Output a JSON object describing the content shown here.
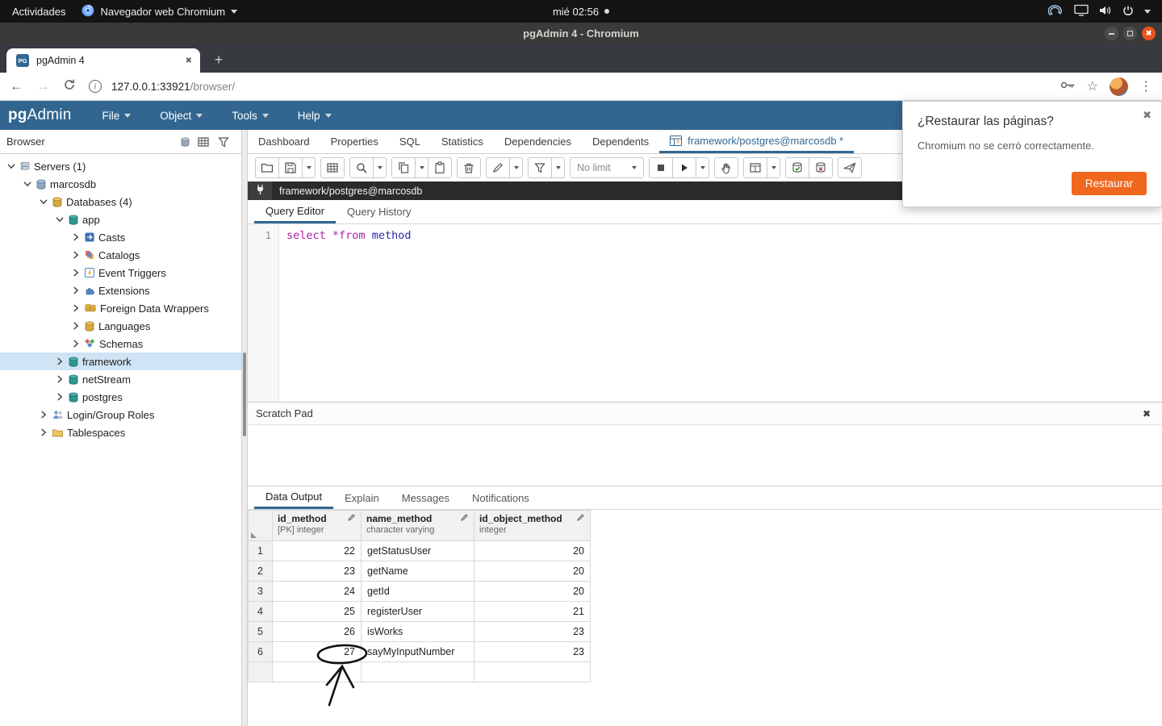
{
  "system_bar": {
    "activities_label": "Actividades",
    "app_menu_label": "Navegador web Chromium",
    "clock": "mié 02:56"
  },
  "window_title": "pgAdmin 4 - Chromium",
  "browser_chrome": {
    "tab_title": "pgAdmin 4",
    "tab_favicon": "PG",
    "url_host": "127.0.0.1:33921",
    "url_path": "/browser/"
  },
  "restore_popup": {
    "title": "¿Restaurar las páginas?",
    "message": "Chromium no se cerró correctamente.",
    "button_label": "Restaurar"
  },
  "pgadmin": {
    "logo": {
      "pg": "pg",
      "admin": "Admin"
    },
    "menus": [
      {
        "label": "File"
      },
      {
        "label": "Object"
      },
      {
        "label": "Tools"
      },
      {
        "label": "Help"
      }
    ],
    "browser_panel": {
      "title": "Browser"
    },
    "tree": [
      {
        "label": "Servers (1)",
        "level": 0,
        "expanded": true,
        "icon": "server-group"
      },
      {
        "label": "marcosdb",
        "level": 1,
        "expanded": true,
        "icon": "server"
      },
      {
        "label": "Databases (4)",
        "level": 2,
        "expanded": true,
        "icon": "db-group"
      },
      {
        "label": "app",
        "level": 3,
        "expanded": true,
        "icon": "database"
      },
      {
        "label": "Casts",
        "level": 4,
        "expanded": false,
        "icon": "casts"
      },
      {
        "label": "Catalogs",
        "level": 4,
        "expanded": false,
        "icon": "catalogs"
      },
      {
        "label": "Event Triggers",
        "level": 4,
        "expanded": false,
        "icon": "event-triggers"
      },
      {
        "label": "Extensions",
        "level": 4,
        "expanded": false,
        "icon": "extensions"
      },
      {
        "label": "Foreign Data Wrappers",
        "level": 4,
        "expanded": false,
        "icon": "fdw"
      },
      {
        "label": "Languages",
        "level": 4,
        "expanded": false,
        "icon": "languages"
      },
      {
        "label": "Schemas",
        "level": 4,
        "expanded": false,
        "icon": "schemas"
      },
      {
        "label": "framework",
        "level": 3,
        "expanded": false,
        "icon": "database",
        "selected": true
      },
      {
        "label": "netStream",
        "level": 3,
        "expanded": false,
        "icon": "database"
      },
      {
        "label": "postgres",
        "level": 3,
        "expanded": false,
        "icon": "database"
      },
      {
        "label": "Login/Group Roles",
        "level": 2,
        "expanded": false,
        "icon": "roles"
      },
      {
        "label": "Tablespaces",
        "level": 2,
        "expanded": false,
        "icon": "tablespaces"
      }
    ],
    "main_tabs": [
      {
        "label": "Dashboard"
      },
      {
        "label": "Properties"
      },
      {
        "label": "SQL"
      },
      {
        "label": "Statistics"
      },
      {
        "label": "Dependencies"
      },
      {
        "label": "Dependents"
      },
      {
        "label": "framework/postgres@marcosdb *",
        "active": true,
        "icon": "query-tool"
      }
    ],
    "toolbar": {
      "limit_label": "No limit",
      "groups": [
        {
          "buttons": [
            {
              "name": "open-file-button",
              "icon": "folder-open"
            },
            {
              "name": "save-file-button",
              "icon": "save",
              "dropdown": true
            }
          ]
        },
        {
          "buttons": [
            {
              "name": "save-data-changes-button",
              "icon": "grid"
            }
          ]
        },
        {
          "buttons": [
            {
              "name": "find-button",
              "icon": "search",
              "dropdown": true
            }
          ]
        },
        {
          "buttons": [
            {
              "name": "copy-button",
              "icon": "copy",
              "dropdown": true
            },
            {
              "name": "paste-button",
              "icon": "paste"
            }
          ]
        },
        {
          "buttons": [
            {
              "name": "delete-button",
              "icon": "trash"
            }
          ]
        },
        {
          "buttons": [
            {
              "name": "edit-button",
              "icon": "pencil",
              "dropdown": true
            }
          ]
        },
        {
          "buttons": [
            {
              "name": "filter-button",
              "icon": "funnel",
              "dropdown": true
            }
          ]
        },
        {
          "type": "limit"
        },
        {
          "buttons": [
            {
              "name": "cancel-query-button",
              "icon": "stop"
            },
            {
              "name": "execute-button",
              "icon": "play",
              "dropdown": true
            }
          ]
        },
        {
          "buttons": [
            {
              "name": "explain-button",
              "icon": "hand"
            }
          ]
        },
        {
          "buttons": [
            {
              "name": "explain-settings-button",
              "icon": "table",
              "dropdown": true
            }
          ]
        },
        {
          "buttons": [
            {
              "name": "commit-button",
              "icon": "db-commit"
            },
            {
              "name": "rollback-button",
              "icon": "db-rollback"
            }
          ]
        },
        {
          "buttons": [
            {
              "name": "download-csv-button",
              "icon": "plane"
            }
          ]
        }
      ]
    },
    "connection_label": "framework/postgres@marcosdb",
    "editor_tabs": [
      {
        "label": "Query Editor",
        "active": true
      },
      {
        "label": "Query History"
      }
    ],
    "editor": {
      "line_number": "1",
      "tokens": [
        {
          "text": "select",
          "type": "keyword"
        },
        {
          "text": " *",
          "type": "operator"
        },
        {
          "text": "from",
          "type": "keyword"
        },
        {
          "text": " method",
          "type": "identifier"
        }
      ]
    },
    "scratch_pad": {
      "title": "Scratch Pad"
    },
    "output_tabs": [
      {
        "label": "Data Output",
        "active": true
      },
      {
        "label": "Explain"
      },
      {
        "label": "Messages"
      },
      {
        "label": "Notifications"
      }
    ],
    "results": {
      "columns": [
        {
          "name": "id_method",
          "type": "[PK] integer",
          "align": "right"
        },
        {
          "name": "name_method",
          "type": "character varying",
          "align": "left"
        },
        {
          "name": "id_object_method",
          "type": "integer",
          "align": "right"
        }
      ],
      "rows": [
        {
          "num": "1",
          "cells": [
            "22",
            "getStatusUser",
            "20"
          ]
        },
        {
          "num": "2",
          "cells": [
            "23",
            "getName",
            "20"
          ]
        },
        {
          "num": "3",
          "cells": [
            "24",
            "getId",
            "20"
          ]
        },
        {
          "num": "4",
          "cells": [
            "25",
            "registerUser",
            "21"
          ]
        },
        {
          "num": "5",
          "cells": [
            "26",
            "isWorks",
            "23"
          ]
        },
        {
          "num": "6",
          "cells": [
            "27",
            "sayMyInputNumber",
            "23"
          ]
        },
        {
          "num": "",
          "cells": [
            "",
            "",
            ""
          ]
        }
      ]
    }
  }
}
